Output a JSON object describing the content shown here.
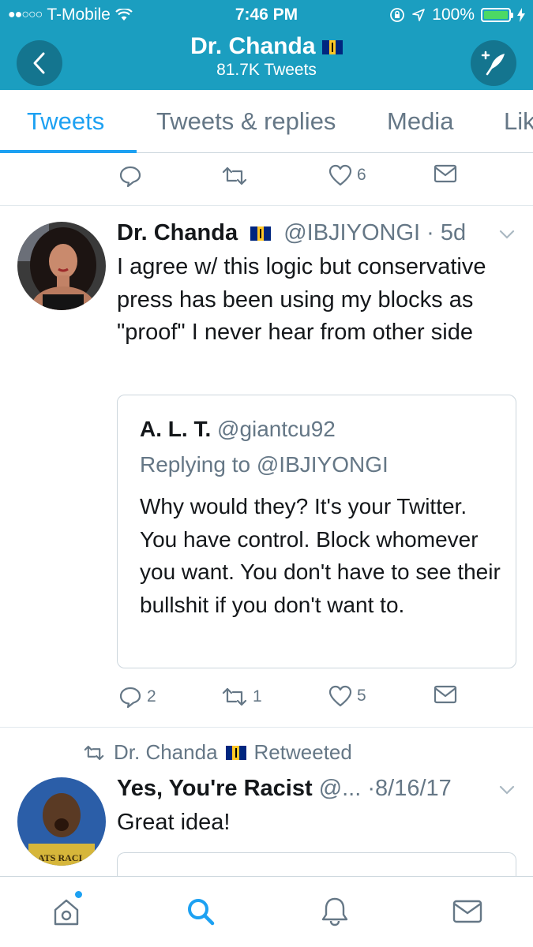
{
  "status_bar": {
    "carrier": "T-Mobile",
    "time": "7:46 PM",
    "battery": "100%"
  },
  "header": {
    "name": "Dr. Chanda",
    "tweet_count": "81.7K Tweets"
  },
  "tabs": [
    {
      "label": "Tweets",
      "active": true
    },
    {
      "label": "Tweets & replies",
      "active": false
    },
    {
      "label": "Media",
      "active": false
    },
    {
      "label": "Likes",
      "active": false
    }
  ],
  "prev_tweet_actions": {
    "reply_count": "",
    "retweet_count": "",
    "like_count": "6"
  },
  "tweet1": {
    "name": "Dr. Chanda",
    "handle": "@IBJIYONGI",
    "time": "5d",
    "text": "I agree w/ this logic but conservative press has been using my blocks as \"proof\" I never hear from other side",
    "quote": {
      "name": "A. L. T.",
      "handle": "@giantcu92",
      "replying_to": "Replying to @IBJIYONGI",
      "text": "Why would they? It's your Twitter. You have control. Block whomever you want. You don't have to see their bullshit if you don't want to."
    },
    "actions": {
      "reply_count": "2",
      "retweet_count": "1",
      "like_count": "5"
    }
  },
  "tweet2": {
    "retweeted_by": "Dr. Chanda",
    "retweeted_label": "Retweeted",
    "name": "Yes, You're Racist",
    "handle": "@...",
    "time": "8/16/17",
    "text": "Great idea!",
    "avatar_shirt_text": "ATS RACI"
  },
  "colors": {
    "header_bg": "#1b9ec0",
    "accent": "#1da1f2",
    "muted": "#657786"
  }
}
